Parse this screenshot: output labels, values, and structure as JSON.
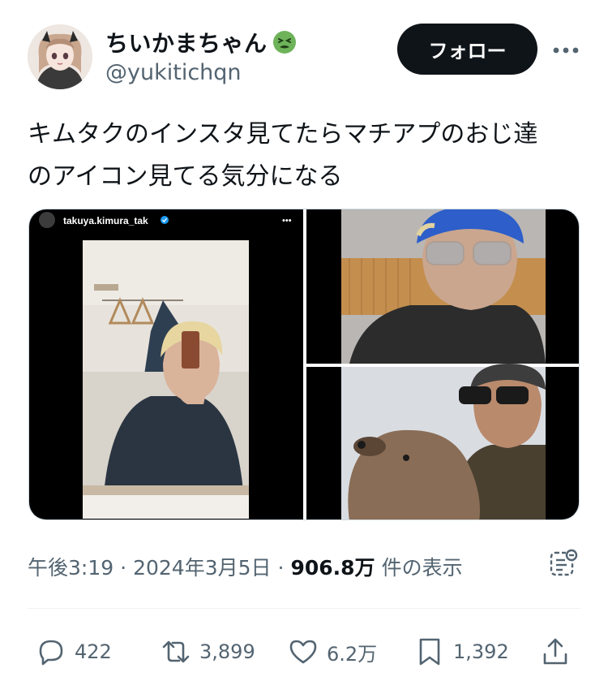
{
  "author": {
    "display_name": "ちいかまちゃん",
    "handle": "@yukitichqn",
    "name_emoji": "nauseated-face-emoji"
  },
  "follow_label": "フォロー",
  "more_icon": "more-horizontal-icon",
  "tweet": {
    "text_line1": "キムタクのインスタ見てたらマチアプのおじ達",
    "text_line2": "のアイコン見てる気分になる"
  },
  "media": {
    "left_image": {
      "overlay_username": "takuya.kimura_tak",
      "overlay_verified": "verified-badge-icon",
      "overlay_more": "•••"
    }
  },
  "meta": {
    "time": "午後3:19",
    "separator": "·",
    "date": "2024年3月5日",
    "views_count": "906.8万",
    "views_label": "件の表示"
  },
  "actions": {
    "replies": "422",
    "reposts": "3,899",
    "likes": "6.2万",
    "bookmarks": "1,392"
  },
  "colors": {
    "text_primary": "#0f1419",
    "text_secondary": "#536471",
    "follow_bg": "#0f1419",
    "emoji_green": "#6eb35a",
    "verified_blue": "#1d9bf0"
  }
}
